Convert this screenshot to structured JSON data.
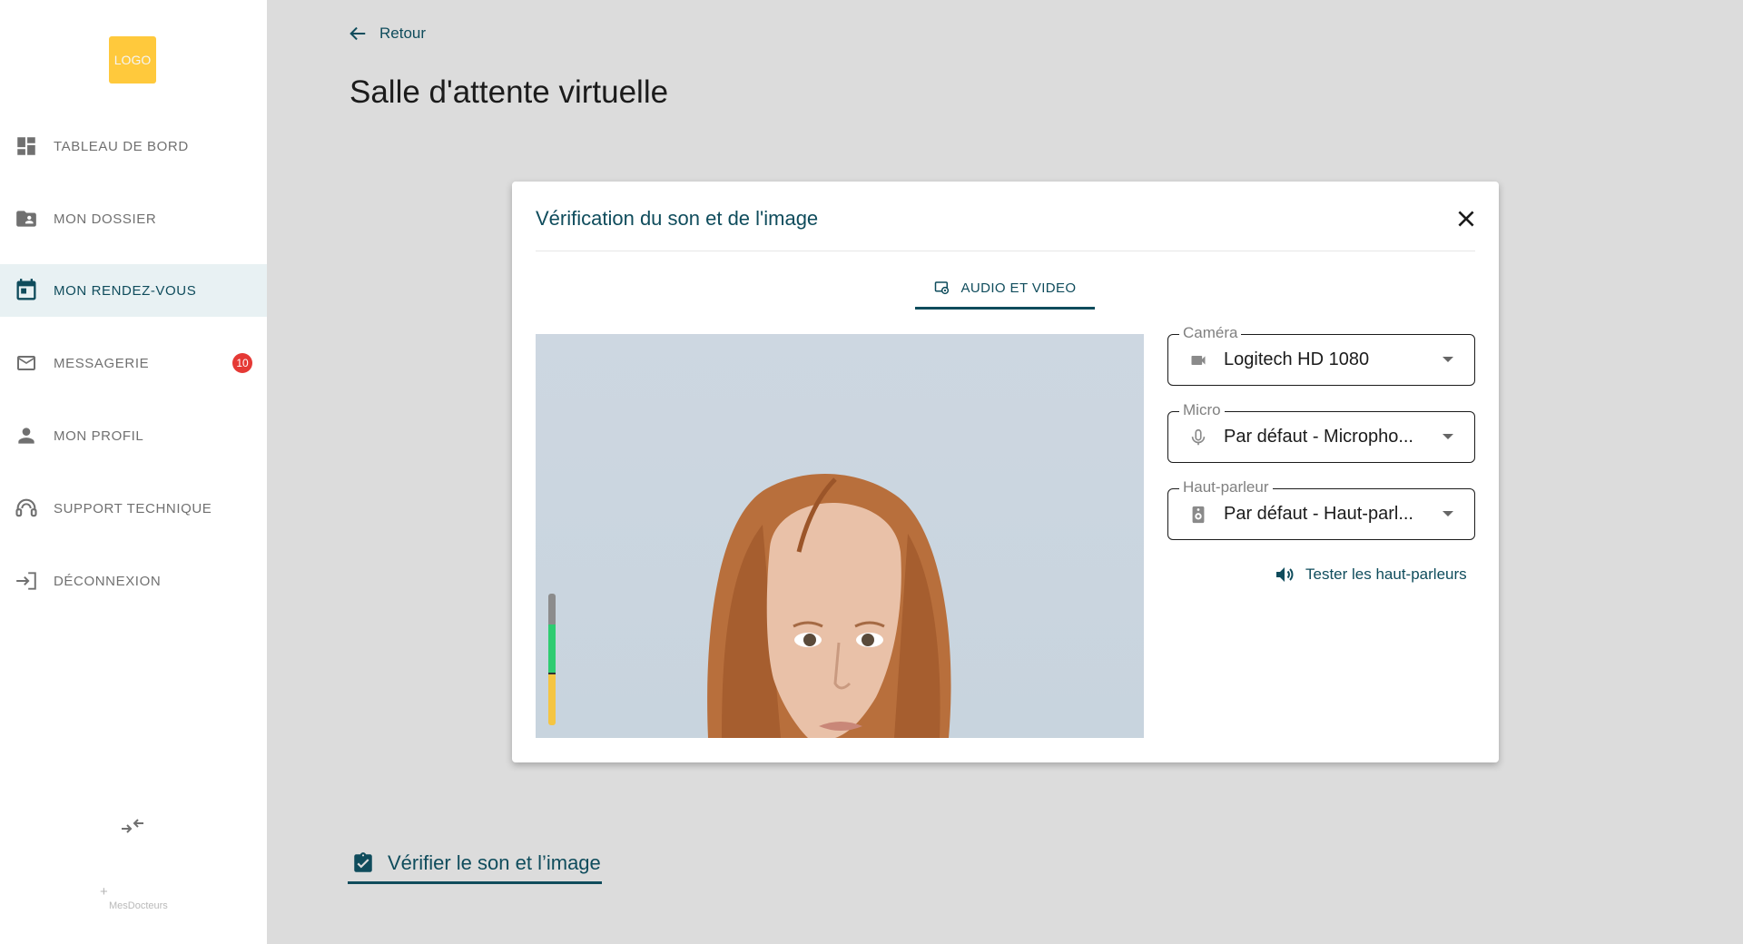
{
  "sidebar": {
    "logo_text": "LOGO",
    "items": [
      {
        "label": "TABLEAU DE BORD",
        "icon": "dashboard-icon"
      },
      {
        "label": "MON DOSSIER",
        "icon": "folder-user-icon"
      },
      {
        "label": "MON RENDEZ-VOUS",
        "icon": "calendar-icon",
        "active": true
      },
      {
        "label": "MESSAGERIE",
        "icon": "mail-icon",
        "badge": "10"
      },
      {
        "label": "MON PROFIL",
        "icon": "person-icon"
      },
      {
        "label": "SUPPORT TECHNIQUE",
        "icon": "headset-icon"
      },
      {
        "label": "DÉCONNEXION",
        "icon": "logout-icon"
      }
    ],
    "brand_text": "MesDocteurs"
  },
  "header": {
    "back_label": "Retour",
    "title": "Salle d'attente virtuelle"
  },
  "modal": {
    "title": "Vérification du son et de l'image",
    "tab_label": "AUDIO ET VIDEO",
    "camera": {
      "label": "Caméra",
      "value": "Logitech HD 1080"
    },
    "micro": {
      "label": "Micro",
      "value": "Par défaut - Micropho..."
    },
    "speaker": {
      "label": "Haut-parleur",
      "value": "Par défaut - Haut-parl..."
    },
    "test_speakers_label": "Tester les haut-parleurs"
  },
  "footer": {
    "verify_label": "Vérifier le son et l’image"
  },
  "colors": {
    "accent": "#0f4c5c",
    "badge": "#e53935",
    "logo": "#ffc93c",
    "background": "#dcdcdc"
  }
}
